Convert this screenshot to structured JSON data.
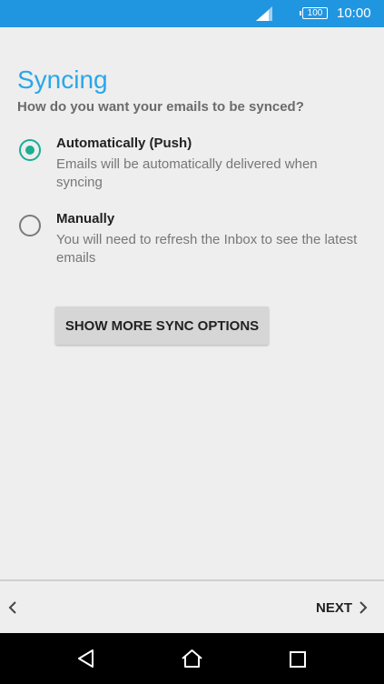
{
  "status_bar": {
    "battery": "100",
    "time": "10:00"
  },
  "page": {
    "title": "Syncing",
    "subtitle": "How do you want your emails to be synced?"
  },
  "options": [
    {
      "title": "Automatically (Push)",
      "description": "Emails will be automatically delivered when syncing",
      "selected": true
    },
    {
      "title": "Manually",
      "description": "You will need to refresh the Inbox to see the latest emails",
      "selected": false
    }
  ],
  "more_button": "SHOW MORE SYNC OPTIONS",
  "footer": {
    "back_icon": "chevron-left-icon",
    "next_label": "NEXT",
    "next_icon": "chevron-right-icon"
  },
  "nav_bar": {
    "icons": [
      "back-triangle-icon",
      "home-icon",
      "recents-square-icon"
    ]
  },
  "colors": {
    "accent": "#29a7e8",
    "status_bar": "#2196e0",
    "radio_checked": "#1aae93"
  }
}
